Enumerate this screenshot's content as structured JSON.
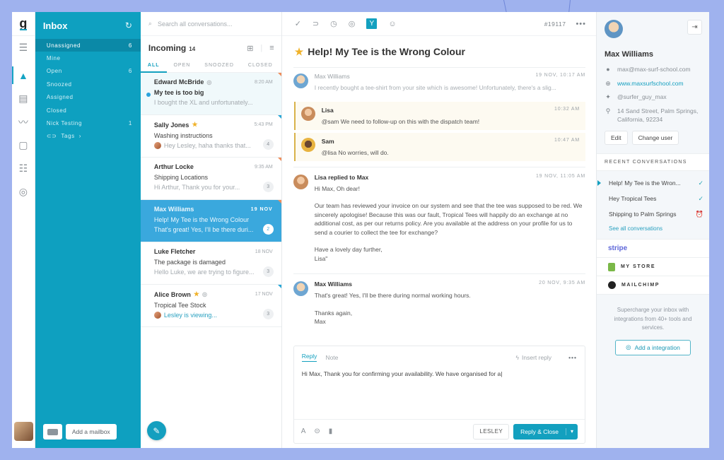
{
  "rail": {
    "logo": "g",
    "icons": [
      "menu-icon",
      "conversations-icon",
      "knowledge-base-icon",
      "reports-icon",
      "chat-icon",
      "settings-sliders-icon",
      "help-icon"
    ]
  },
  "inbox": {
    "title": "Inbox",
    "items": [
      {
        "label": "Unassigned",
        "count": "6"
      },
      {
        "label": "Mine",
        "count": ""
      },
      {
        "label": "Open",
        "count": "6"
      },
      {
        "label": "Snoozed",
        "count": ""
      },
      {
        "label": "Assigned",
        "count": ""
      },
      {
        "label": "Closed",
        "count": ""
      },
      {
        "label": "Nick Testing",
        "count": "1"
      }
    ],
    "tags_label": "Tags",
    "add_mailbox_label": "Add a mailbox"
  },
  "list": {
    "search_placeholder": "Search all conversations...",
    "title": "Incoming",
    "count": "14",
    "tabs": [
      "ALL",
      "OPEN",
      "SNOOZED",
      "CLOSED"
    ],
    "conversations": [
      {
        "name": "Edward McBride",
        "time": "8:20 AM",
        "subject": "My tee is too big",
        "preview": "I bought the XL and unfortunately...",
        "badge": ""
      },
      {
        "name": "Sally Jones",
        "time": "5:43 PM",
        "subject": "Washing instructions",
        "preview": "Hey Lesley, haha thanks that...",
        "badge": "4"
      },
      {
        "name": "Arthur Locke",
        "time": "9:35 AM",
        "subject": "Shipping Locations",
        "preview": "Hi Arthur, Thank you for your...",
        "badge": "3"
      },
      {
        "name": "Max Williams",
        "time": "19 NOV",
        "subject": "Help! My Tee is the Wrong Colour",
        "preview": "That's great! Yes, I'll be there duri...",
        "badge": "2"
      },
      {
        "name": "Luke Fletcher",
        "time": "18 NOV",
        "subject": "The package is damaged",
        "preview": "Hello Luke, we are trying to figure...",
        "badge": "3"
      },
      {
        "name": "Alice Brown",
        "time": "17 NOV",
        "subject": "Tropical Tee Stock",
        "preview": "Lesley is viewing...",
        "badge": "3"
      }
    ]
  },
  "main": {
    "ticket_number": "#19117",
    "subject": "Help! My Tee is the Wrong Colour",
    "messages": [
      {
        "author": "Max Williams",
        "time": "19 NOV, 10:17 AM",
        "text": "I recently bought a tee-shirt from your site which is awesome! Unfortunately, there's a slig..."
      },
      {
        "author": "Lisa",
        "time": "10:32 AM",
        "text": "@sam We need to follow-up on this with the dispatch team!"
      },
      {
        "author": "Sam",
        "time": "10:47 AM",
        "text": "@lisa No worries, will do."
      },
      {
        "author": "Lisa replied to Max",
        "time": "19 NOV, 11:05 AM",
        "greeting": "Hi Max, Oh dear!",
        "text": "Our team has reviewed your invoice on our system and see that the tee was supposed to be red. We sincerely apologise! Because this was our fault, Tropical Tees will happily do an exchange at no additional cost, as per our returns policy. Are you available at the address on your profile for us to send a courier to collect the tee for exchange?",
        "signoff": "Have a lovely day further,",
        "signature": "Lisa\""
      },
      {
        "author": "Max Williams",
        "time": "20 NOV, 9:35 AM",
        "text": "That's great! Yes, I'll be there during normal working hours.",
        "signoff": "Thanks again,",
        "signature": "Max"
      }
    ],
    "composer": {
      "tab_reply": "Reply",
      "tab_note": "Note",
      "insert_reply": "Insert reply",
      "text": "Hi Max, Thank you for confirming your availability. We have organised for a|",
      "assignee": "LESLEY",
      "send_label": "Reply & Close"
    }
  },
  "profile": {
    "name": "Max Williams",
    "email": "max@max-surf-school.com",
    "website": "www.maxsurfschool.com",
    "twitter": "@surfer_guy_max",
    "address": "14 Sand Street, Palm Springs, California, 92234",
    "edit_label": "Edit",
    "change_user_label": "Change user",
    "recent_header": "RECENT CONVERSATIONS",
    "recent": [
      {
        "title": "Help! My Tee is the Wron...",
        "status": "✓"
      },
      {
        "title": "Hey Tropical Tees",
        "status": "✓"
      },
      {
        "title": "Shipping to Palm Springs",
        "status": "⏰"
      }
    ],
    "see_all": "See all conversations",
    "integrations": [
      "stripe",
      "MY STORE",
      "MAILCHIMP"
    ],
    "integration_note": "Supercharge your inbox with integrations from 40+ tools and services.",
    "add_integration_label": "Add a integration"
  },
  "colors": {
    "accent": "#0ea0c0",
    "selected_row": "#3aa8dd",
    "note_border": "#d9b34a",
    "background": "#9fb2ee"
  }
}
